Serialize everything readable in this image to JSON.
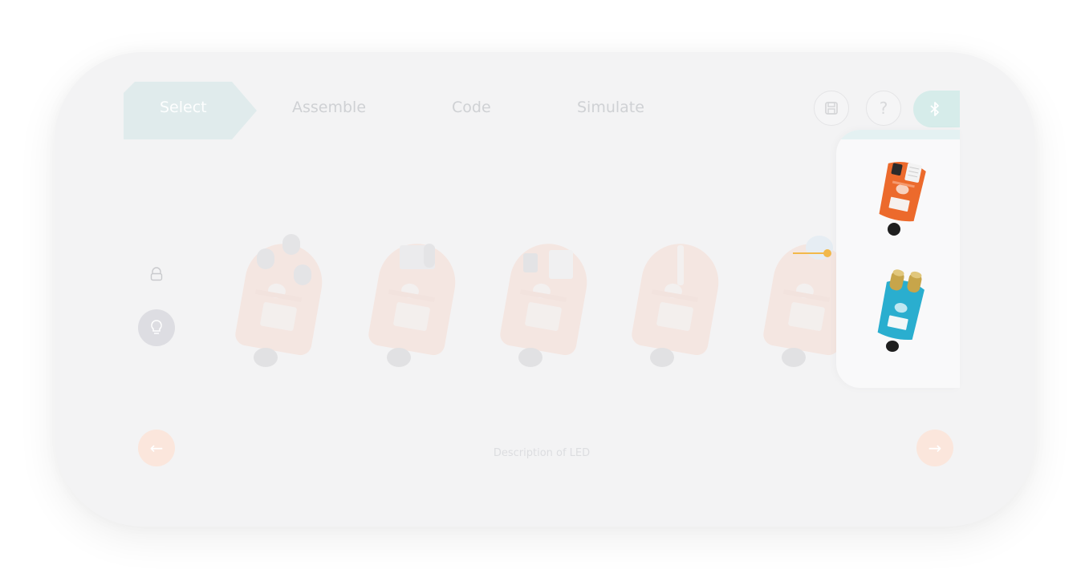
{
  "steps": [
    {
      "label": "Select",
      "active": true
    },
    {
      "label": "Assemble",
      "active": false
    },
    {
      "label": "Code",
      "active": false
    },
    {
      "label": "Simulate",
      "active": false
    }
  ],
  "header": {
    "save_icon": "save-icon",
    "help_icon": "help-icon",
    "help_glyph": "?",
    "bluetooth_icon": "bluetooth-icon",
    "bluetooth_glyph": "✱"
  },
  "modes": {
    "lock_icon": "lock-icon",
    "bulb_icon": "bulb-icon"
  },
  "modules": [
    {
      "name": "module-buttons"
    },
    {
      "name": "module-switch"
    },
    {
      "name": "module-temperature-humidity"
    },
    {
      "name": "module-slider"
    },
    {
      "name": "module-knob"
    }
  ],
  "popup": {
    "items": [
      {
        "name": "temperature-humidity-sensor",
        "color": "#ec6a2c"
      },
      {
        "name": "ultrasonic-sensor",
        "color": "#2aaecf"
      }
    ],
    "pointer_color": "#f2b84a"
  },
  "footer": {
    "description": "Description of LED",
    "prev_glyph": "←",
    "next_glyph": "→"
  },
  "colors": {
    "accent_orange": "#f47b3b",
    "accent_teal": "#d6ecea",
    "card_bg": "#f3f3f4"
  }
}
